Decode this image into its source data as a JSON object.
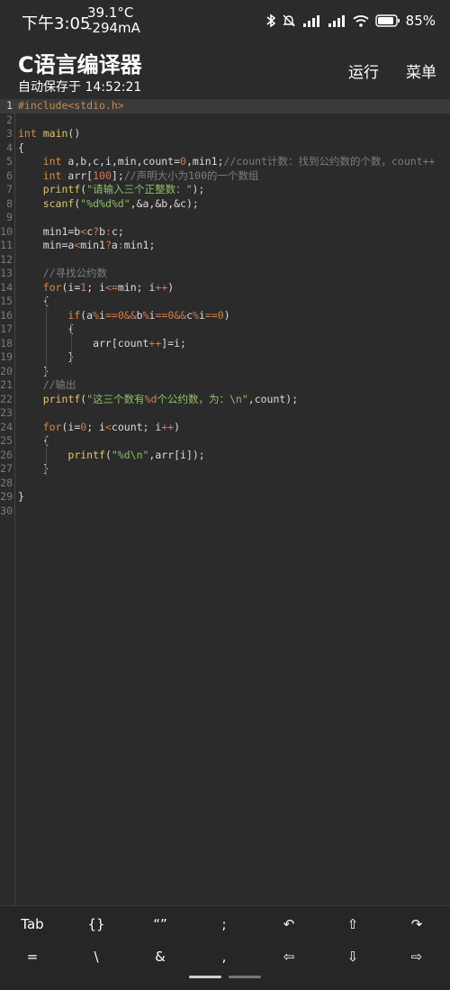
{
  "status": {
    "time": "下午3:05",
    "temp": "39.1°C",
    "current": "-294mA",
    "battery": "85%",
    "icons": [
      "bluetooth-icon",
      "mute-bell-icon",
      "signal-hd-icon",
      "signal-hd-icon",
      "wifi-icon",
      "battery-icon"
    ]
  },
  "app": {
    "title": "C语言编译器",
    "subtitle": "自动保存于 14:52:21",
    "run_label": "运行",
    "menu_label": "菜单"
  },
  "editor": {
    "current_line": 1,
    "lines": [
      [
        [
          "pp",
          "#include<stdio.h>"
        ]
      ],
      [],
      [
        [
          "kw",
          "int"
        ],
        [
          "",
          " "
        ],
        [
          "fn",
          "main"
        ],
        [
          "",
          "()"
        ]
      ],
      [
        [
          "",
          "{"
        ]
      ],
      [
        [
          "",
          "    "
        ],
        [
          "kw",
          "int"
        ],
        [
          "",
          " a,b,c,i,min,count="
        ],
        [
          "num",
          "0"
        ],
        [
          "",
          ",min1;"
        ],
        [
          "cm",
          "//count计数：找到公约数的个数，count++"
        ]
      ],
      [
        [
          "",
          "    "
        ],
        [
          "kw",
          "int"
        ],
        [
          "",
          " arr["
        ],
        [
          "num",
          "100"
        ],
        [
          "",
          "];"
        ],
        [
          "cm",
          "//声明大小为100的一个数组"
        ]
      ],
      [
        [
          "",
          "    "
        ],
        [
          "fn",
          "printf"
        ],
        [
          "",
          "("
        ],
        [
          "str",
          "\"请输入三个正整数：\""
        ],
        [
          "",
          ");"
        ]
      ],
      [
        [
          "",
          "    "
        ],
        [
          "fn",
          "scanf"
        ],
        [
          "",
          "("
        ],
        [
          "str",
          "\"%d%d%d\""
        ],
        [
          "",
          ",&a,&b,&c);"
        ]
      ],
      [],
      [
        [
          "",
          "    min1=b"
        ],
        [
          "op",
          "<"
        ],
        [
          "",
          "c"
        ],
        [
          "op",
          "?"
        ],
        [
          "",
          "b"
        ],
        [
          "op",
          ":"
        ],
        [
          "",
          "c;"
        ]
      ],
      [
        [
          "",
          "    min=a"
        ],
        [
          "op",
          "<"
        ],
        [
          "",
          "min1"
        ],
        [
          "op",
          "?"
        ],
        [
          "",
          "a"
        ],
        [
          "op",
          ":"
        ],
        [
          "",
          "min1;"
        ]
      ],
      [],
      [
        [
          "",
          "    "
        ],
        [
          "cm",
          "//寻找公约数"
        ]
      ],
      [
        [
          "",
          "    "
        ],
        [
          "kw",
          "for"
        ],
        [
          "",
          "(i="
        ],
        [
          "num",
          "1"
        ],
        [
          "",
          "; i"
        ],
        [
          "op",
          "<="
        ],
        [
          "",
          "min; i"
        ],
        [
          "op",
          "++"
        ],
        [
          "",
          ")"
        ]
      ],
      [
        [
          "",
          "    {"
        ]
      ],
      [
        [
          "",
          "        "
        ],
        [
          "kw",
          "if"
        ],
        [
          "",
          "(a"
        ],
        [
          "op",
          "%"
        ],
        [
          "",
          "i"
        ],
        [
          "op",
          "=="
        ],
        [
          "num",
          "0"
        ],
        [
          "op",
          "&&"
        ],
        [
          "",
          "b"
        ],
        [
          "op",
          "%"
        ],
        [
          "",
          "i"
        ],
        [
          "op",
          "=="
        ],
        [
          "num",
          "0"
        ],
        [
          "op",
          "&&"
        ],
        [
          "",
          "c"
        ],
        [
          "op",
          "%"
        ],
        [
          "",
          "i"
        ],
        [
          "op",
          "=="
        ],
        [
          "num",
          "0"
        ],
        [
          "",
          ")"
        ]
      ],
      [
        [
          "",
          "        {"
        ]
      ],
      [
        [
          "",
          "            arr[count"
        ],
        [
          "op",
          "++"
        ],
        [
          "",
          "]=i;"
        ]
      ],
      [
        [
          "",
          "        }"
        ]
      ],
      [
        [
          "",
          "    }"
        ]
      ],
      [
        [
          "",
          "    "
        ],
        [
          "cm",
          "//输出"
        ]
      ],
      [
        [
          "",
          "    "
        ],
        [
          "fn",
          "printf"
        ],
        [
          "",
          "("
        ],
        [
          "str",
          "\"这三个数有"
        ],
        [
          "num",
          "%d"
        ],
        [
          "str",
          "个公约数，为：\\n\""
        ],
        [
          "",
          ",count);"
        ]
      ],
      [],
      [
        [
          "",
          "    "
        ],
        [
          "kw",
          "for"
        ],
        [
          "",
          "(i="
        ],
        [
          "num",
          "0"
        ],
        [
          "",
          "; i"
        ],
        [
          "op",
          "<"
        ],
        [
          "",
          "count; i"
        ],
        [
          "op",
          "++"
        ],
        [
          "",
          ")"
        ]
      ],
      [
        [
          "",
          "    {"
        ]
      ],
      [
        [
          "",
          "        "
        ],
        [
          "fn",
          "printf"
        ],
        [
          "",
          "("
        ],
        [
          "str",
          "\"%d\\n\""
        ],
        [
          "",
          ",arr[i]);"
        ]
      ],
      [
        [
          "",
          "    }"
        ]
      ],
      [],
      [
        [
          "",
          "}"
        ]
      ],
      []
    ],
    "guides": [
      {
        "from": 15,
        "to": 20,
        "col": 4
      },
      {
        "from": 17,
        "to": 19,
        "col": 8
      },
      {
        "from": 25,
        "to": 27,
        "col": 4
      }
    ]
  },
  "symbols": {
    "row1": [
      {
        "label": "Tab",
        "name": "tab-key"
      },
      {
        "label": "{}",
        "name": "braces-key"
      },
      {
        "label": "“”",
        "name": "quotes-key"
      },
      {
        "label": ";",
        "name": "semicolon-key"
      },
      {
        "label": "↶",
        "name": "undo-icon"
      },
      {
        "label": "⇧",
        "name": "arrow-up-icon"
      },
      {
        "label": "↷",
        "name": "redo-icon"
      }
    ],
    "row2": [
      {
        "label": "=",
        "name": "equals-key"
      },
      {
        "label": "\\",
        "name": "backslash-key"
      },
      {
        "label": "&",
        "name": "ampersand-key"
      },
      {
        "label": ",",
        "name": "comma-key"
      },
      {
        "label": "⇦",
        "name": "arrow-left-icon"
      },
      {
        "label": "⇩",
        "name": "arrow-down-icon"
      },
      {
        "label": "⇨",
        "name": "arrow-right-icon"
      }
    ]
  }
}
